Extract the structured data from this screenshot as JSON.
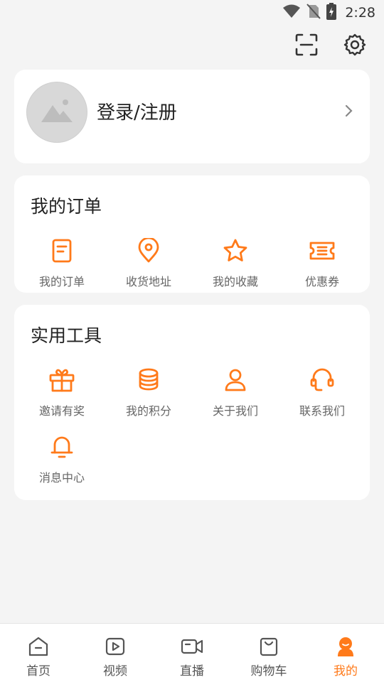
{
  "status_bar": {
    "time": "2:28"
  },
  "profile": {
    "login_label": "登录/注册"
  },
  "orders": {
    "title": "我的订单",
    "items": [
      {
        "label": "我的订单",
        "icon": "document-icon"
      },
      {
        "label": "收货地址",
        "icon": "location-pin-icon"
      },
      {
        "label": "我的收藏",
        "icon": "star-icon"
      },
      {
        "label": "优惠券",
        "icon": "coupon-icon"
      }
    ]
  },
  "tools": {
    "title": "实用工具",
    "items": [
      {
        "label": "邀请有奖",
        "icon": "gift-icon"
      },
      {
        "label": "我的积分",
        "icon": "coins-icon"
      },
      {
        "label": "关于我们",
        "icon": "user-icon"
      },
      {
        "label": "联系我们",
        "icon": "headset-icon"
      },
      {
        "label": "消息中心",
        "icon": "bell-icon"
      }
    ]
  },
  "tabbar": {
    "items": [
      {
        "label": "首页",
        "icon": "home-icon"
      },
      {
        "label": "视频",
        "icon": "video-play-icon"
      },
      {
        "label": "直播",
        "icon": "camera-icon"
      },
      {
        "label": "购物车",
        "icon": "shopping-bag-icon"
      },
      {
        "label": "我的",
        "icon": "profile-icon"
      }
    ],
    "active_index": 4
  },
  "colors": {
    "accent": "#ff7a1a",
    "background": "#f4f4f4",
    "card": "#ffffff"
  }
}
